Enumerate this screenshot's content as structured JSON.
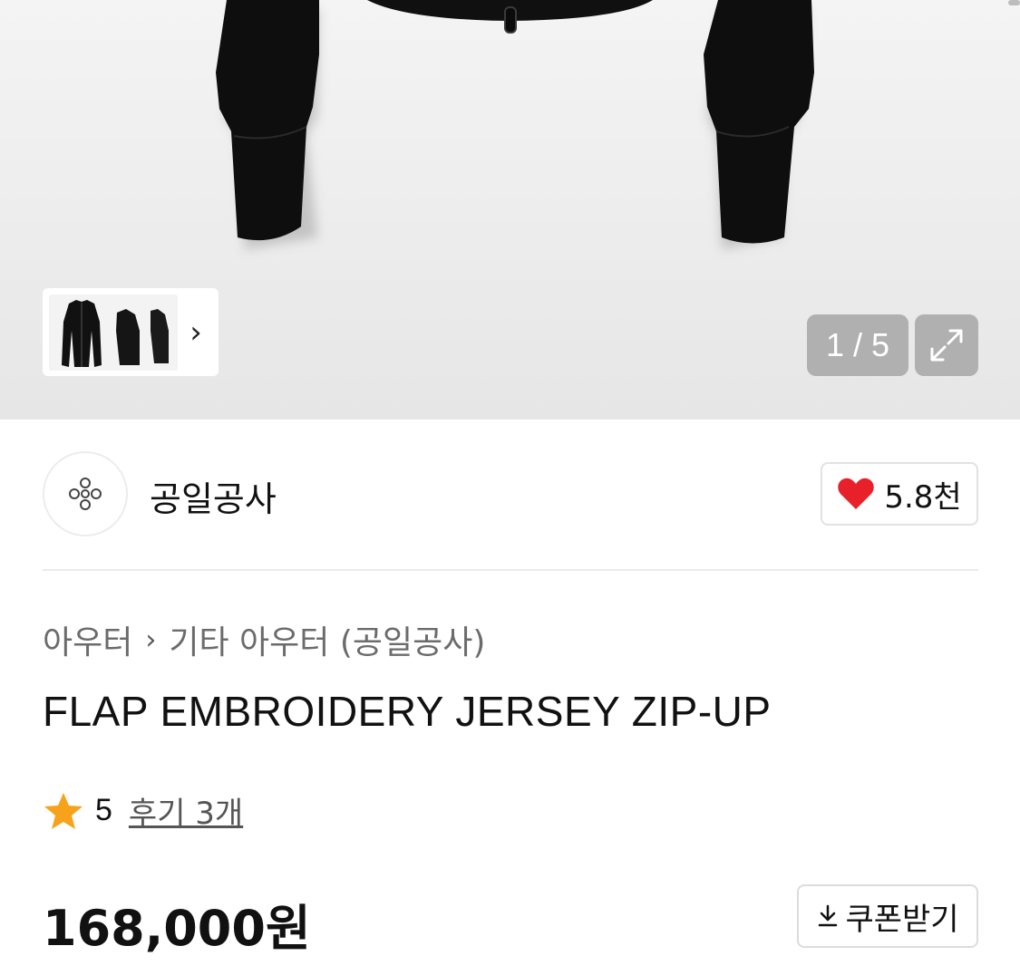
{
  "gallery": {
    "page_indicator": "1 / 5",
    "thumbnail_next_icon": "chevron-right-icon",
    "expand_icon": "expand-icon"
  },
  "brand": {
    "name": "공일공사",
    "logo_icon": "brand-logo-icon",
    "like_icon": "heart-icon",
    "like_count": "5.8천",
    "like_color": "#e8202a"
  },
  "breadcrumb": {
    "category": "아우터",
    "separator_icon": "chevron-right-icon",
    "subcategory": "기타 아우터 (공일공사)"
  },
  "product": {
    "title": "FLAP EMBROIDERY JERSEY ZIP-UP",
    "rating_icon": "star-icon",
    "rating_color": "#f7a21b",
    "rating": "5",
    "review_link": "후기 3개",
    "price": "168,000원",
    "coupon_icon": "download-icon",
    "coupon_label": "쿠폰받기"
  }
}
